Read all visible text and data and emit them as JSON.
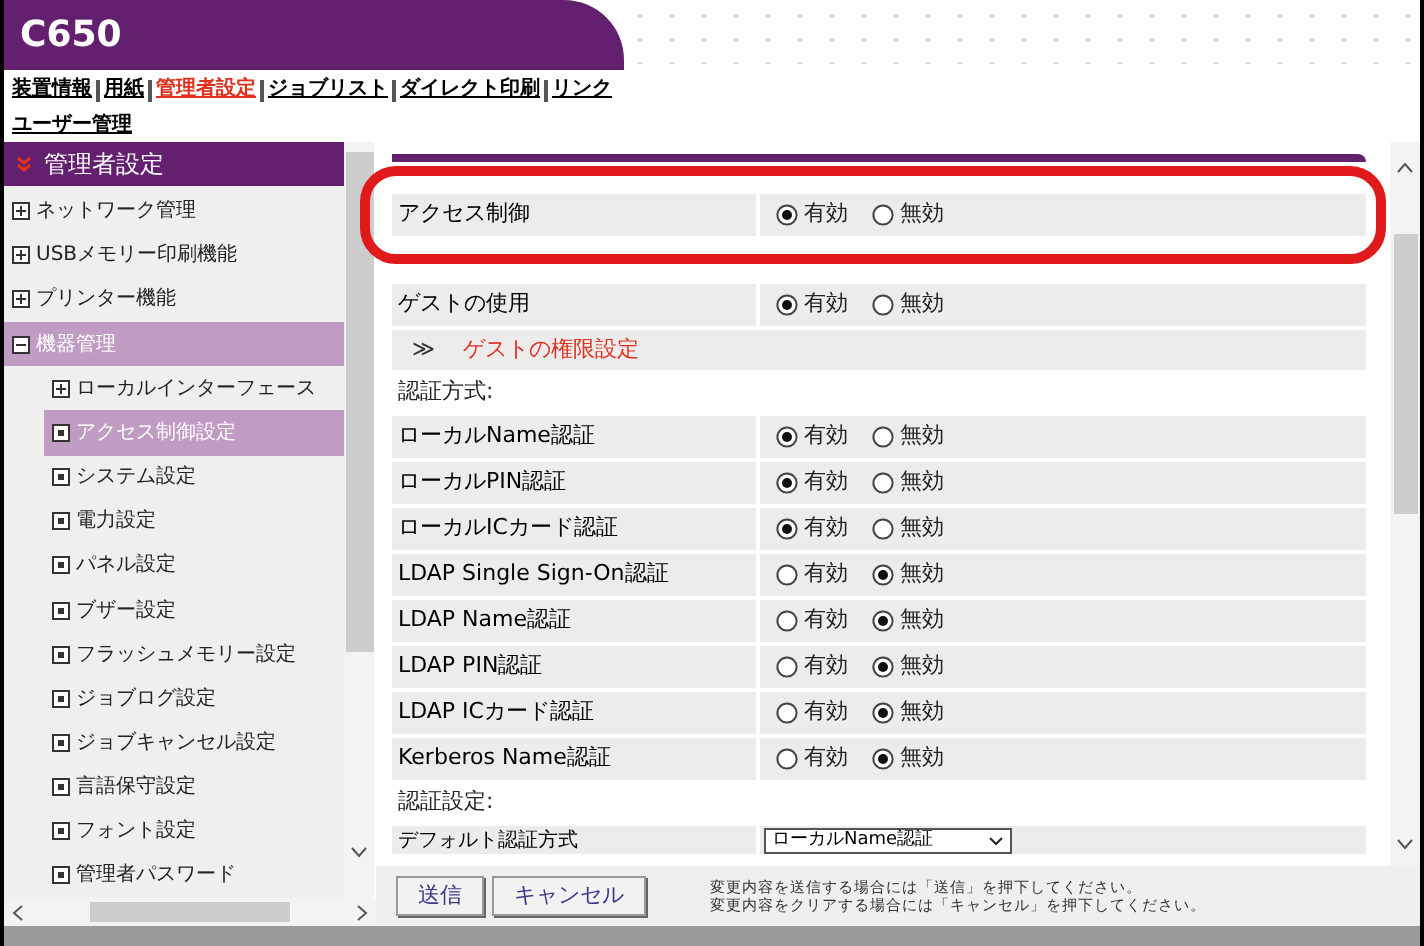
{
  "header": {
    "title": "C650"
  },
  "nav_links": [
    {
      "label": "装置情報",
      "selected": false
    },
    {
      "label": "用紙",
      "selected": false
    },
    {
      "label": "管理者設定",
      "selected": true
    },
    {
      "label": "ジョブリスト",
      "selected": false
    },
    {
      "label": "ダイレクト印刷",
      "selected": false
    },
    {
      "label": "リンク",
      "selected": false
    },
    {
      "label": "ユーザー管理",
      "selected": false
    }
  ],
  "sidebar": {
    "title": "管理者設定",
    "items": [
      {
        "label": "ネットワーク管理",
        "kind": "group",
        "expanded": false,
        "selected": false
      },
      {
        "label": "USBメモリー印刷機能",
        "kind": "group",
        "expanded": false,
        "selected": false
      },
      {
        "label": "プリンター機能",
        "kind": "group",
        "expanded": false,
        "selected": false
      },
      {
        "label": "機器管理",
        "kind": "group",
        "expanded": true,
        "selected": true,
        "children": [
          {
            "label": "ローカルインターフェース",
            "kind": "group",
            "expanded": false,
            "selected": false
          },
          {
            "label": "アクセス制御設定",
            "kind": "page",
            "selected": true
          },
          {
            "label": "システム設定",
            "kind": "page",
            "selected": false
          },
          {
            "label": "電力設定",
            "kind": "page",
            "selected": false
          },
          {
            "label": "パネル設定",
            "kind": "page",
            "selected": false
          },
          {
            "label": "ブザー設定",
            "kind": "page",
            "selected": false
          },
          {
            "label": "フラッシュメモリー設定",
            "kind": "page",
            "selected": false
          },
          {
            "label": "ジョブログ設定",
            "kind": "page",
            "selected": false
          },
          {
            "label": "ジョブキャンセル設定",
            "kind": "page",
            "selected": false
          },
          {
            "label": "言語保守設定",
            "kind": "page",
            "selected": false
          },
          {
            "label": "フォント設定",
            "kind": "page",
            "selected": false
          },
          {
            "label": "管理者パスワード",
            "kind": "page",
            "selected": false
          }
        ]
      }
    ]
  },
  "settings": [
    {
      "kind": "radio_row",
      "label": "アクセス制御",
      "highlighted": true,
      "options": [
        {
          "label": "有効",
          "selected": true
        },
        {
          "label": "無効",
          "selected": false
        }
      ]
    },
    {
      "kind": "radio_row",
      "label": "ゲストの使用",
      "highlighted": false,
      "options": [
        {
          "label": "有効",
          "selected": true
        },
        {
          "label": "無効",
          "selected": false
        }
      ]
    },
    {
      "kind": "link",
      "icon": "≫",
      "label": "ゲストの権限設定"
    },
    {
      "kind": "heading",
      "label": "認証方式:"
    },
    {
      "kind": "radio_row",
      "label": "ローカルName認証",
      "highlighted": false,
      "options": [
        {
          "label": "有効",
          "selected": true
        },
        {
          "label": "無効",
          "selected": false
        }
      ]
    },
    {
      "kind": "radio_row",
      "label": "ローカルPIN認証",
      "highlighted": false,
      "options": [
        {
          "label": "有効",
          "selected": true
        },
        {
          "label": "無効",
          "selected": false
        }
      ]
    },
    {
      "kind": "radio_row",
      "label": "ローカルICカード認証",
      "highlighted": false,
      "options": [
        {
          "label": "有効",
          "selected": true
        },
        {
          "label": "無効",
          "selected": false
        }
      ]
    },
    {
      "kind": "radio_row",
      "label": "LDAP Single Sign-On認証",
      "highlighted": false,
      "options": [
        {
          "label": "有効",
          "selected": false
        },
        {
          "label": "無効",
          "selected": true
        }
      ]
    },
    {
      "kind": "radio_row",
      "label": "LDAP Name認証",
      "highlighted": false,
      "options": [
        {
          "label": "有効",
          "selected": false
        },
        {
          "label": "無効",
          "selected": true
        }
      ]
    },
    {
      "kind": "radio_row",
      "label": "LDAP PIN認証",
      "highlighted": false,
      "options": [
        {
          "label": "有効",
          "selected": false
        },
        {
          "label": "無効",
          "selected": true
        }
      ]
    },
    {
      "kind": "radio_row",
      "label": "LDAP ICカード認証",
      "highlighted": false,
      "options": [
        {
          "label": "有効",
          "selected": false
        },
        {
          "label": "無効",
          "selected": true
        }
      ]
    },
    {
      "kind": "radio_row",
      "label": "Kerberos Name認証",
      "highlighted": false,
      "options": [
        {
          "label": "有効",
          "selected": false
        },
        {
          "label": "無効",
          "selected": true
        }
      ]
    },
    {
      "kind": "heading",
      "label": "認証設定:"
    },
    {
      "kind": "select_row",
      "label": "デフォルト認証方式",
      "value": "ローカルName認証"
    }
  ],
  "buttons": [
    "送信",
    "キャンセル"
  ],
  "help_lines": [
    "変更内容を送信する場合には「送信」を押下してください。",
    "変更内容をクリアする場合には「キャンセル」を押下してください。"
  ]
}
